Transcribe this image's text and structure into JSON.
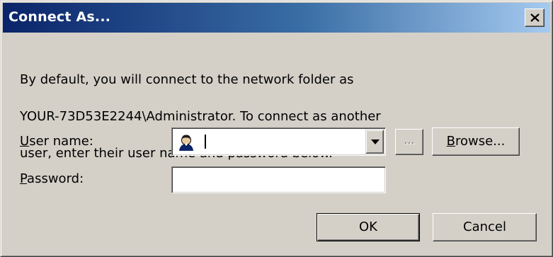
{
  "dialog": {
    "title": "Connect As...",
    "close_label": "X",
    "message_lines": [
      "By default, you will connect to the network folder as",
      "YOUR-73D53E2244\\Administrator. To connect as another",
      "user, enter their user name and password below."
    ]
  },
  "form": {
    "username": {
      "label_mnemonic": "U",
      "label_rest": "ser name:",
      "value": "",
      "icon": "user-icon"
    },
    "ellipsis_label": "...",
    "browse": {
      "mnemonic": "B",
      "rest": "rowse..."
    },
    "password": {
      "label_mnemonic": "P",
      "label_rest": "assword:",
      "value": ""
    }
  },
  "buttons": {
    "ok": "OK",
    "cancel": "Cancel"
  },
  "colors": {
    "titlebar_start": "#0a246a",
    "titlebar_end": "#a6caf0",
    "window_face": "#d4d0c8"
  }
}
